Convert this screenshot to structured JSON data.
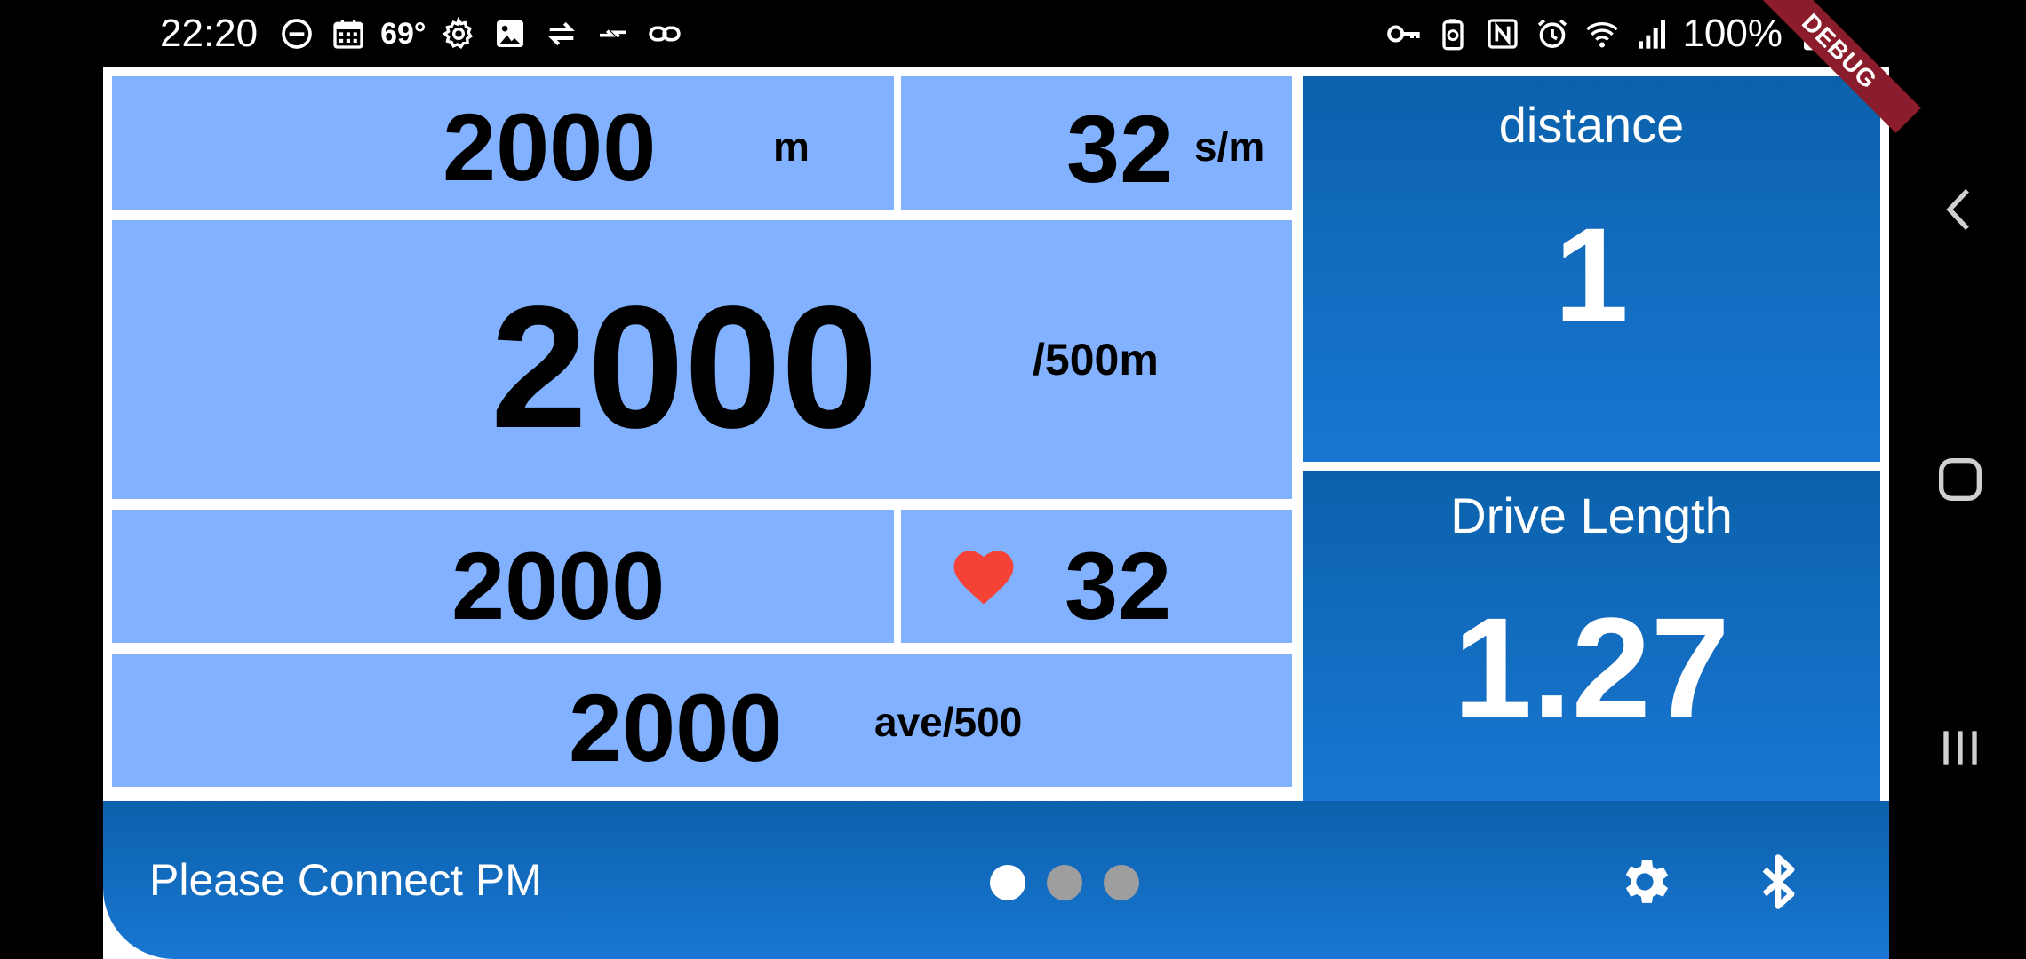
{
  "status_bar": {
    "time": "22:20",
    "temperature": "69°",
    "battery": "100%",
    "left_icons": [
      "do-not-disturb-icon",
      "calendar-icon",
      "weather-temp",
      "settings-icon",
      "gallery-icon",
      "sync-arrows-icon",
      "data-transfer-icon",
      "link-icon"
    ],
    "right_icons": [
      "vpn-key-icon",
      "battery-saver-icon",
      "nfc-icon",
      "alarm-icon",
      "wifi-icon",
      "signal-icon",
      "battery-icon"
    ]
  },
  "debug_banner": "DEBUG",
  "metrics": {
    "top_left": {
      "value": "2000",
      "unit": "m"
    },
    "top_right": {
      "value": "32",
      "unit": "s/m"
    },
    "main": {
      "value": "2000",
      "unit": "/500m"
    },
    "mid_left": {
      "value": "2000"
    },
    "heart_rate": {
      "value": "32",
      "icon": "heart-icon"
    },
    "average": {
      "value": "2000",
      "unit": "ave/500"
    }
  },
  "side_panels": [
    {
      "title": "distance",
      "value": "1"
    },
    {
      "title": "Drive Length",
      "value": "1.27"
    }
  ],
  "bottom_bar": {
    "message": "Please Connect PM",
    "page_dots": 3,
    "active_dot": 0,
    "settings_icon": "gear-icon",
    "bluetooth_icon": "bluetooth-icon"
  },
  "nav_bar": {
    "buttons": [
      "back-icon",
      "home-icon",
      "recents-icon"
    ]
  },
  "colors": {
    "cell_bg": "#82b1ff",
    "panel_dark": "#0b61ab",
    "panel_light": "#1976d2",
    "heart": "#f44336",
    "debug_ribbon": "#8b1c2c"
  }
}
